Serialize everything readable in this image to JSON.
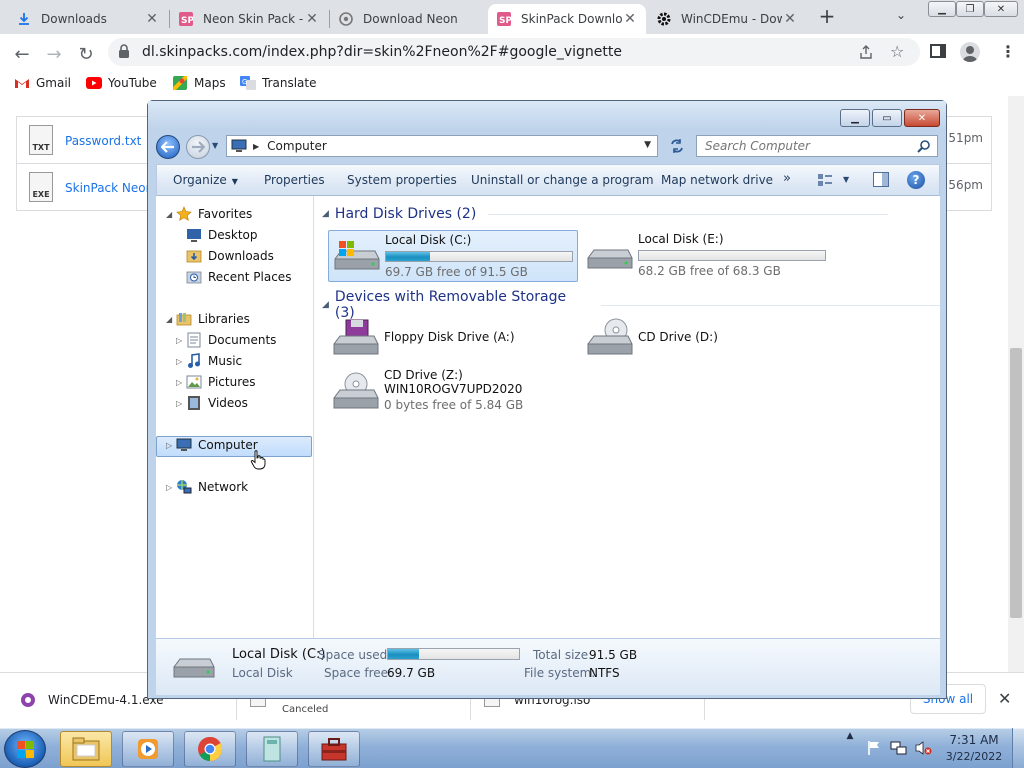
{
  "browser": {
    "tabs": [
      {
        "title": "Downloads",
        "icon": "download-icon",
        "active": false
      },
      {
        "title": "Neon Skin Pack -",
        "icon": "skinpack-icon",
        "active": false
      },
      {
        "title": "Download Neon",
        "icon": "chrome-page-icon",
        "active": false
      },
      {
        "title": "SkinPack Downlo",
        "icon": "skinpack-icon",
        "active": true
      },
      {
        "title": "WinCDEmu - Dow",
        "icon": "gear-icon",
        "active": false
      }
    ],
    "new_tab_symbol": "+",
    "url": "dl.skinpacks.com/index.php?dir=skin%2Fneon%2F#google_vignette",
    "bookmarks": [
      {
        "label": "Gmail",
        "icon": "gmail-icon"
      },
      {
        "label": "YouTube",
        "icon": "youtube-icon"
      },
      {
        "label": "Maps",
        "icon": "maps-icon"
      },
      {
        "label": "Translate",
        "icon": "translate-icon"
      }
    ]
  },
  "page": {
    "files": [
      {
        "name": "Password.txt",
        "ext": "TXT",
        "time": ":51pm"
      },
      {
        "name": "SkinPack Neon",
        "ext": "EXE",
        "time": ":56pm"
      }
    ]
  },
  "explorer": {
    "address": "Computer",
    "search_placeholder": "Search Computer",
    "commands": {
      "organize": "Organize",
      "properties": "Properties",
      "system_properties": "System properties",
      "uninstall": "Uninstall or change a program",
      "map_drive": "Map network drive",
      "more": "»"
    },
    "nav": {
      "favorites": "Favorites",
      "desktop": "Desktop",
      "downloads": "Downloads",
      "recent": "Recent Places",
      "libraries": "Libraries",
      "documents": "Documents",
      "music": "Music",
      "pictures": "Pictures",
      "videos": "Videos",
      "computer": "Computer",
      "network": "Network"
    },
    "groups": {
      "hdd": "Hard Disk Drives (2)",
      "removable": "Devices with Removable Storage (3)"
    },
    "drives": {
      "c": {
        "name": "Local Disk (C:)",
        "free": "69.7 GB free of 91.5 GB",
        "used_fraction": 0.238
      },
      "e": {
        "name": "Local Disk (E:)",
        "free": "68.2 GB free of 68.3 GB",
        "used_fraction": 0.002
      },
      "a": {
        "name": "Floppy Disk Drive (A:)"
      },
      "d": {
        "name": "CD Drive (D:)"
      },
      "z": {
        "name": "CD Drive (Z:)",
        "label": "WIN10ROGV7UPD2020",
        "free": "0 bytes free of 5.84 GB"
      }
    },
    "details": {
      "name": "Local Disk (C:)",
      "type": "Local Disk",
      "space_used_label": "Space used:",
      "space_free_label": "Space free:",
      "space_free": "69.7 GB",
      "total_label": "Total size:",
      "total": "91.5 GB",
      "fs_label": "File system:",
      "fs": "NTFS",
      "used_fraction": 0.238
    }
  },
  "downloads_bar": {
    "items": [
      {
        "name": "WinCDEmu-4.1.exe",
        "status": ""
      },
      {
        "name": "",
        "status": "Canceled"
      },
      {
        "name": "win10rog.iso",
        "status": ""
      }
    ],
    "show_all": "Show all"
  },
  "taskbar": {
    "time": "7:31 AM",
    "date": "3/22/2022"
  }
}
